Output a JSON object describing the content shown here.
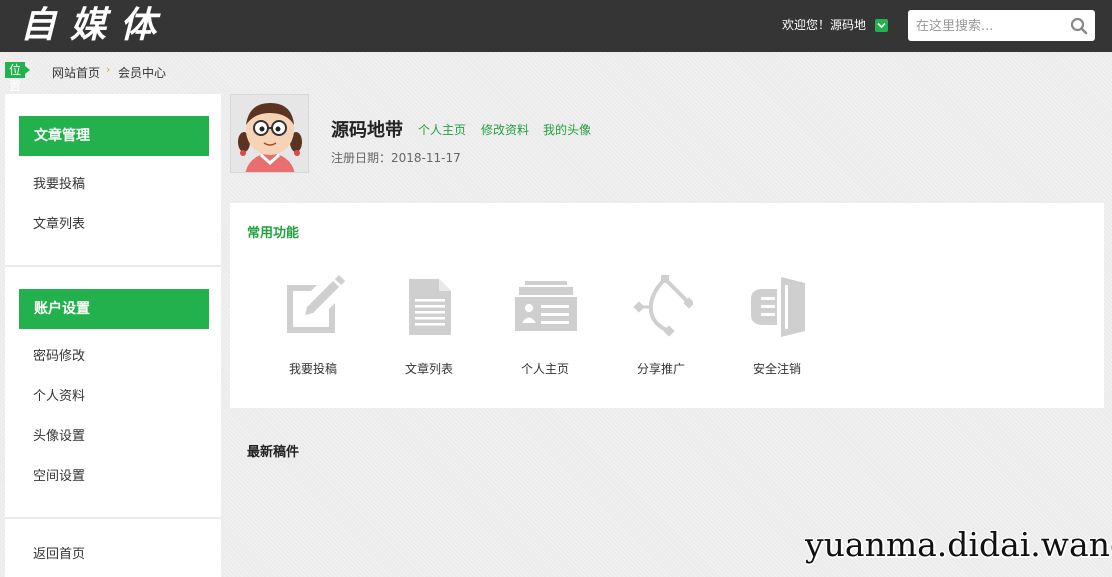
{
  "header": {
    "logo_text": "自媒体",
    "welcome": "欢迎您！源码地",
    "search_placeholder": "在这里搜索..."
  },
  "breadcrumb": {
    "tag": "位置",
    "home": "网站首页",
    "current": "会员中心"
  },
  "sidebar": {
    "sections": [
      {
        "title": "文章管理",
        "items": [
          "我要投稿",
          "文章列表"
        ]
      },
      {
        "title": "账户设置",
        "items": [
          "密码修改",
          "个人资料",
          "头像设置",
          "空间设置"
        ]
      }
    ],
    "footer_item": "返回首页"
  },
  "profile": {
    "username": "源码地带",
    "links": [
      "个人主页",
      "修改资料",
      "我的头像"
    ],
    "reg_date": "注册日期：2018-11-17"
  },
  "functions": {
    "title": "常用功能",
    "items": [
      {
        "label": "我要投稿",
        "icon": "edit-icon"
      },
      {
        "label": "文章列表",
        "icon": "document-icon"
      },
      {
        "label": "个人主页",
        "icon": "profile-card-icon"
      },
      {
        "label": "分享推广",
        "icon": "share-icon"
      },
      {
        "label": "安全注销",
        "icon": "logout-icon"
      }
    ]
  },
  "latest": {
    "title": "最新稿件"
  },
  "watermark": "yuanma.didai.wang",
  "colors": {
    "header_bg": "#353535",
    "accent": "#22b14c",
    "link": "#22a13c"
  }
}
